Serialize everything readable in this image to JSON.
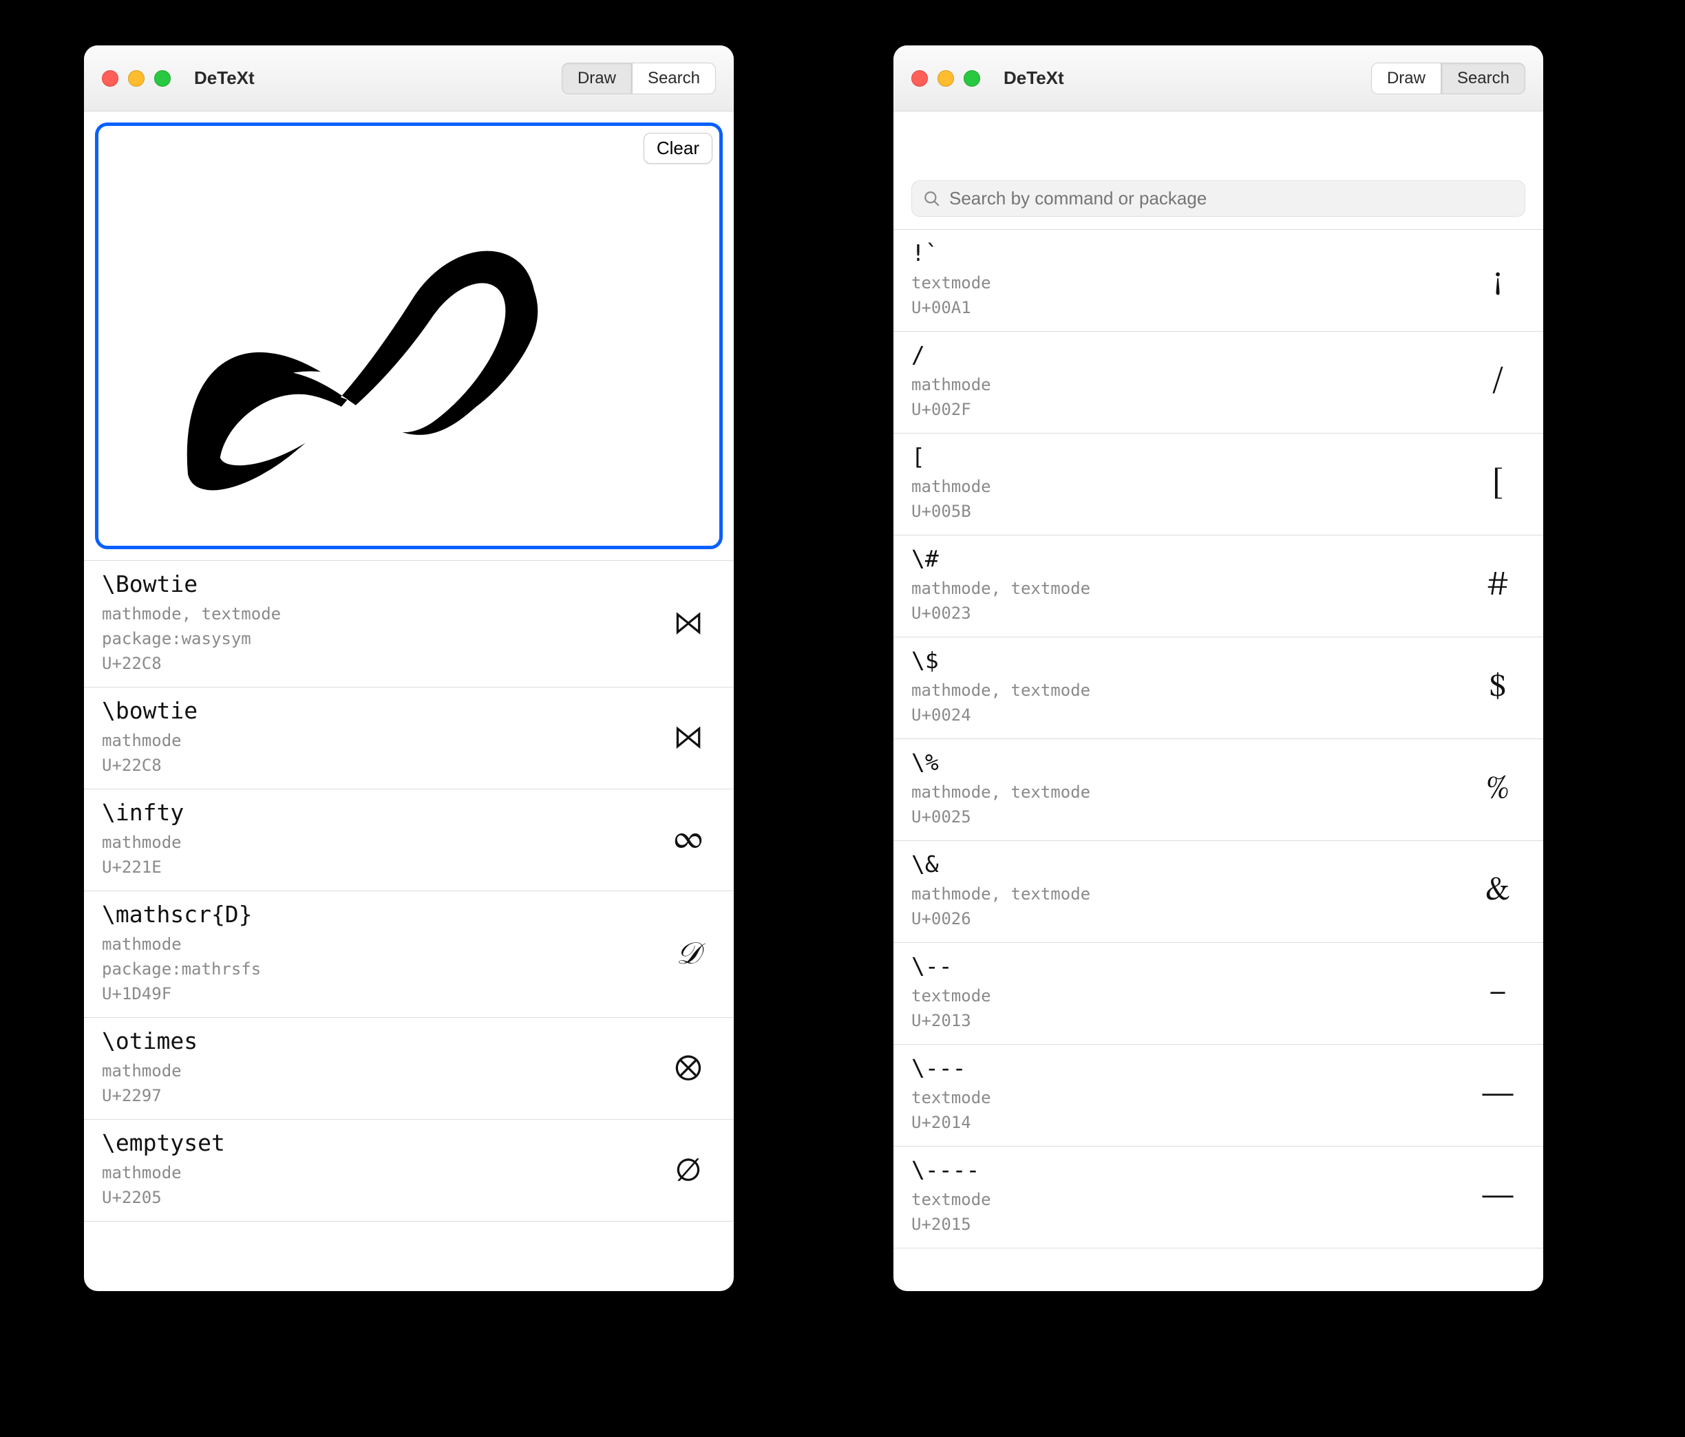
{
  "app_title": "DeTeXt",
  "tabs": {
    "draw": "Draw",
    "search": "Search"
  },
  "clear_label": "Clear",
  "search_placeholder": "Search by command or package",
  "left_active_tab": "draw",
  "right_active_tab": "search",
  "left_results": [
    {
      "command": "\\Bowtie",
      "modes": "mathmode, textmode",
      "package": "package:wasysym",
      "unicode": "U+22C8",
      "glyph": "⋈"
    },
    {
      "command": "\\bowtie",
      "modes": "mathmode",
      "package": "",
      "unicode": "U+22C8",
      "glyph": "⋈"
    },
    {
      "command": "\\infty",
      "modes": "mathmode",
      "package": "",
      "unicode": "U+221E",
      "glyph": "∞"
    },
    {
      "command": "\\mathscr{D}",
      "modes": "mathmode",
      "package": "package:mathrsfs",
      "unicode": "U+1D49F",
      "glyph": "𝒟",
      "glyph_class": "script"
    },
    {
      "command": "\\otimes",
      "modes": "mathmode",
      "package": "",
      "unicode": "U+2297",
      "glyph": "⊗"
    },
    {
      "command": "\\emptyset",
      "modes": "mathmode",
      "package": "",
      "unicode": "U+2205",
      "glyph": "∅"
    }
  ],
  "right_results": [
    {
      "command": "!`",
      "modes": "textmode",
      "package": "",
      "unicode": "U+00A1",
      "glyph": "¡"
    },
    {
      "command": "/",
      "modes": "mathmode",
      "package": "",
      "unicode": "U+002F",
      "glyph": "/"
    },
    {
      "command": "[",
      "modes": "mathmode",
      "package": "",
      "unicode": "U+005B",
      "glyph": "["
    },
    {
      "command": "\\#",
      "modes": "mathmode, textmode",
      "package": "",
      "unicode": "U+0023",
      "glyph": "#"
    },
    {
      "command": "\\$",
      "modes": "mathmode, textmode",
      "package": "",
      "unicode": "U+0024",
      "glyph": "$"
    },
    {
      "command": "\\%",
      "modes": "mathmode, textmode",
      "package": "",
      "unicode": "U+0025",
      "glyph": "%"
    },
    {
      "command": "\\&",
      "modes": "mathmode, textmode",
      "package": "",
      "unicode": "U+0026",
      "glyph": "&"
    },
    {
      "command": "\\--",
      "modes": "textmode",
      "package": "",
      "unicode": "U+2013",
      "glyph": "–"
    },
    {
      "command": "\\---",
      "modes": "textmode",
      "package": "",
      "unicode": "U+2014",
      "glyph": "—"
    },
    {
      "command": "\\----",
      "modes": "textmode",
      "package": "",
      "unicode": "U+2015",
      "glyph": "―"
    }
  ]
}
